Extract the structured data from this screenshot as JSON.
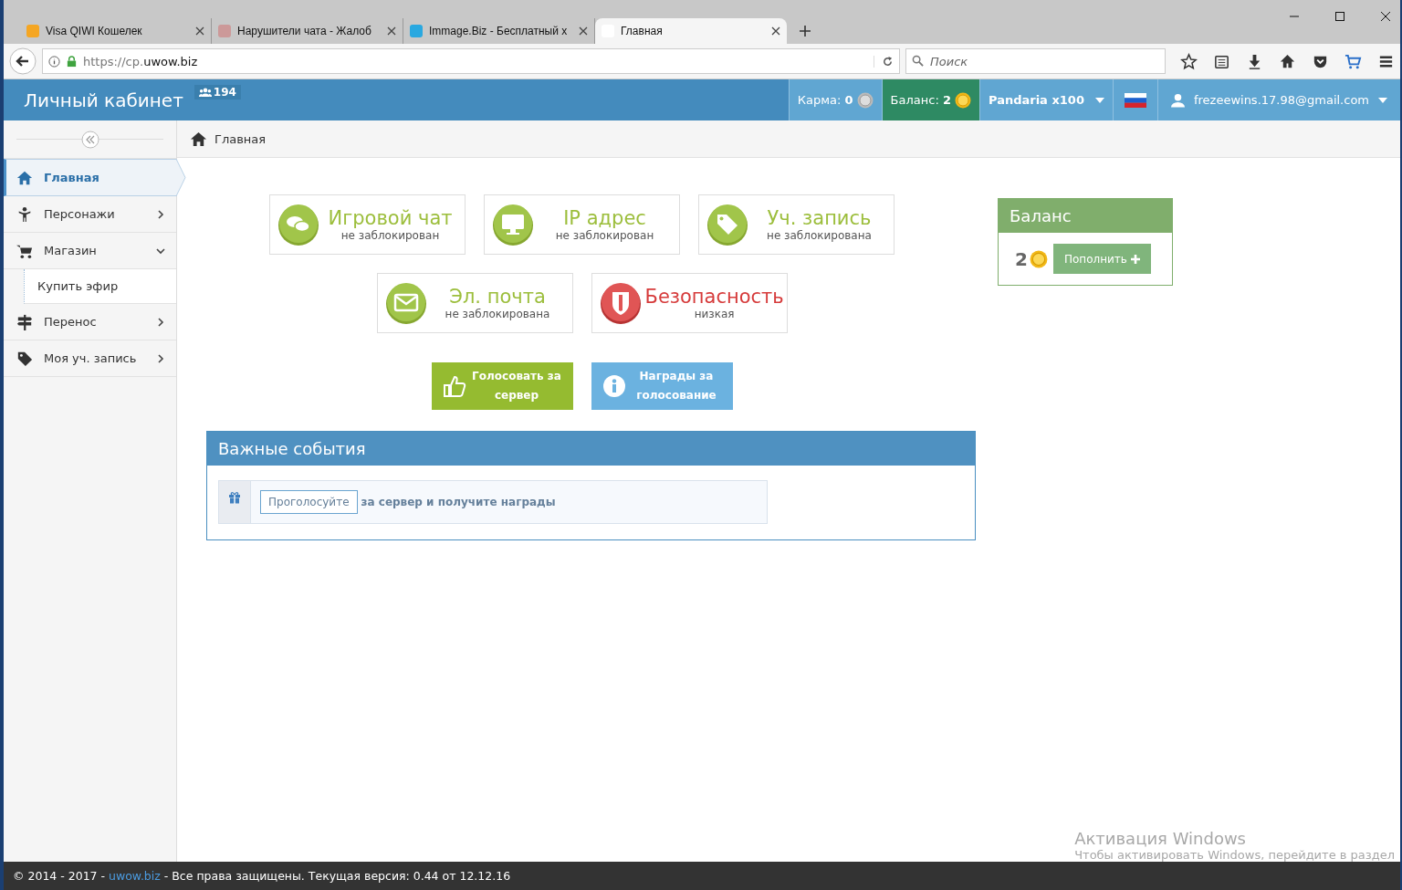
{
  "browser": {
    "tabs": [
      {
        "title": "Visa QIWI Кошелек",
        "selected": false
      },
      {
        "title": "Нарушители чата - Жалоб",
        "selected": false
      },
      {
        "title": "Immage.Biz - Бесплатный х",
        "selected": false
      },
      {
        "title": "Главная",
        "selected": true
      }
    ],
    "address": {
      "prefix": "https://cp.",
      "domain": "uwow.biz"
    },
    "search": {
      "placeholder": "Поиск"
    }
  },
  "header": {
    "title": "Личный кабинет",
    "online_count": "194",
    "karma_label": "Карма:",
    "karma_value": "0",
    "balance_label": "Баланс:",
    "balance_value": "2",
    "realm": "Pandaria x100",
    "user": "frezeewins.17.98@gmail.com"
  },
  "breadcrumb": "Главная",
  "sidebar": {
    "items": [
      {
        "label": "Главная",
        "selected": true
      },
      {
        "label": "Персонажи",
        "selected": false,
        "expanded": false
      },
      {
        "label": "Магазин",
        "selected": false,
        "expanded": true,
        "children": [
          {
            "label": "Купить эфир",
            "selected": false
          }
        ]
      },
      {
        "label": "Перенос",
        "selected": false,
        "expanded": false
      },
      {
        "label": "Моя уч. запись",
        "selected": false,
        "expanded": false
      }
    ]
  },
  "status_cards": [
    {
      "title": "Игровой чат",
      "status": "не заблокирован",
      "kind": "ok"
    },
    {
      "title": "IP адрес",
      "status": "не заблокирован",
      "kind": "ok"
    },
    {
      "title": "Уч. запись",
      "status": "не заблокирована",
      "kind": "ok"
    },
    {
      "title": "Эл. почта",
      "status": "не заблокирована",
      "kind": "ok"
    },
    {
      "title": "Безопасность",
      "status": "низкая",
      "kind": "danger"
    }
  ],
  "actions": [
    {
      "label": "Голосовать за сервер",
      "kind": "vote"
    },
    {
      "label": "Награды за голосование",
      "kind": "info"
    }
  ],
  "balance_panel": {
    "title": "Баланс",
    "amount": "2",
    "button": "Пополнить"
  },
  "events": {
    "title": "Важные события",
    "items": [
      {
        "button": "Проголосуйте",
        "text": "за сервер и получите награды"
      }
    ]
  },
  "footer": {
    "before": "© 2014 - 2017 - ",
    "link": "uwow.biz",
    "after": " - Все права защищены. Текущая версия: 0.44 от 12.12.16"
  },
  "activation": {
    "title": "Активация Windows",
    "text": "Чтобы активировать Windows, перейдите в раздел"
  }
}
